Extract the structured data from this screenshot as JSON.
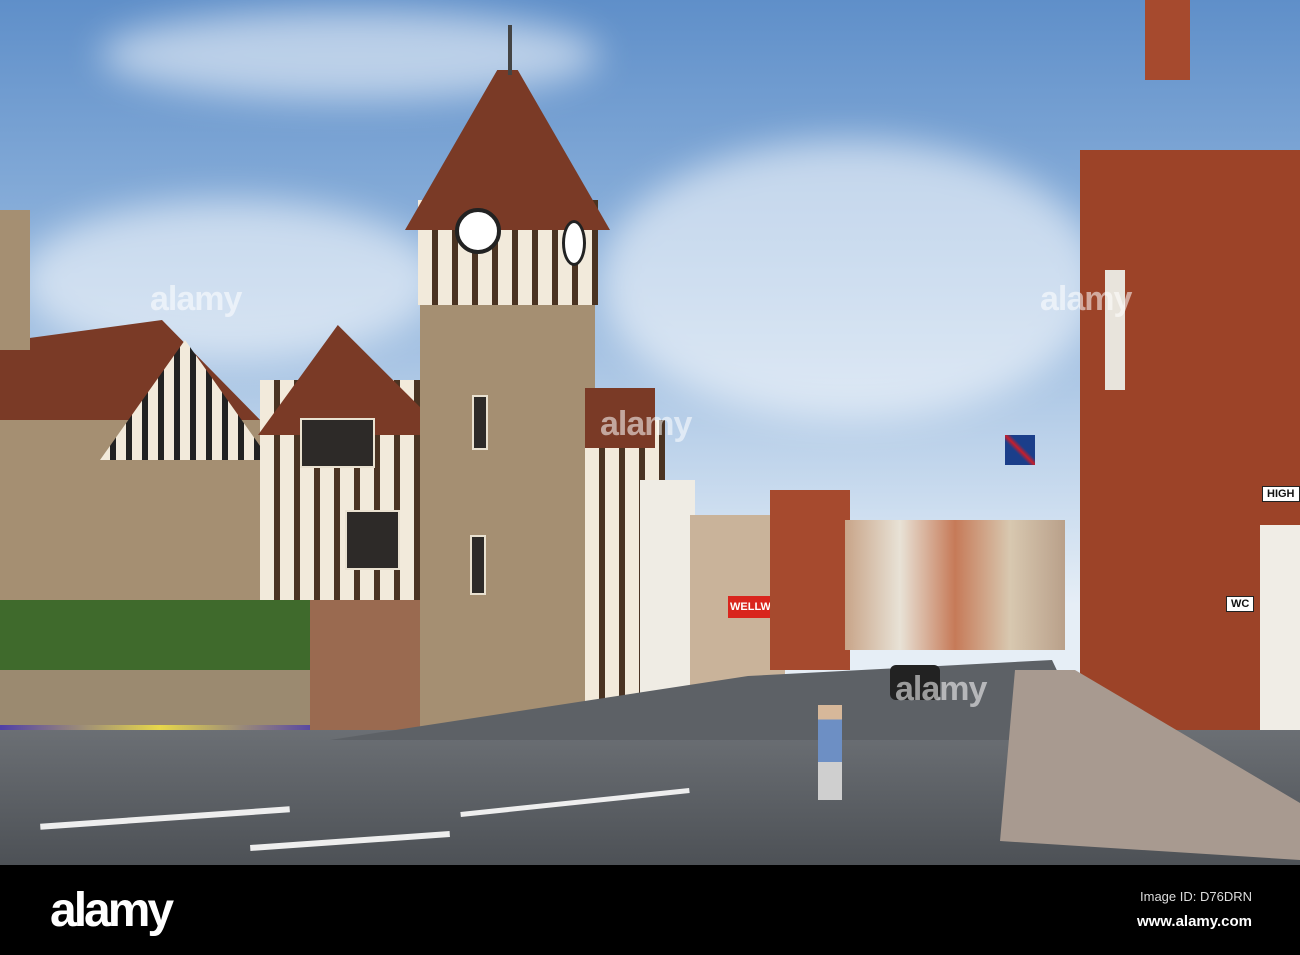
{
  "watermark": {
    "text": "alamy"
  },
  "footer": {
    "logo": "alamy",
    "image_id": "Image ID: D76DRN",
    "url": "www.alamy.com"
  },
  "signs": {
    "shop": "WELLWORTH",
    "wc": "WC",
    "street": "HIGH"
  }
}
